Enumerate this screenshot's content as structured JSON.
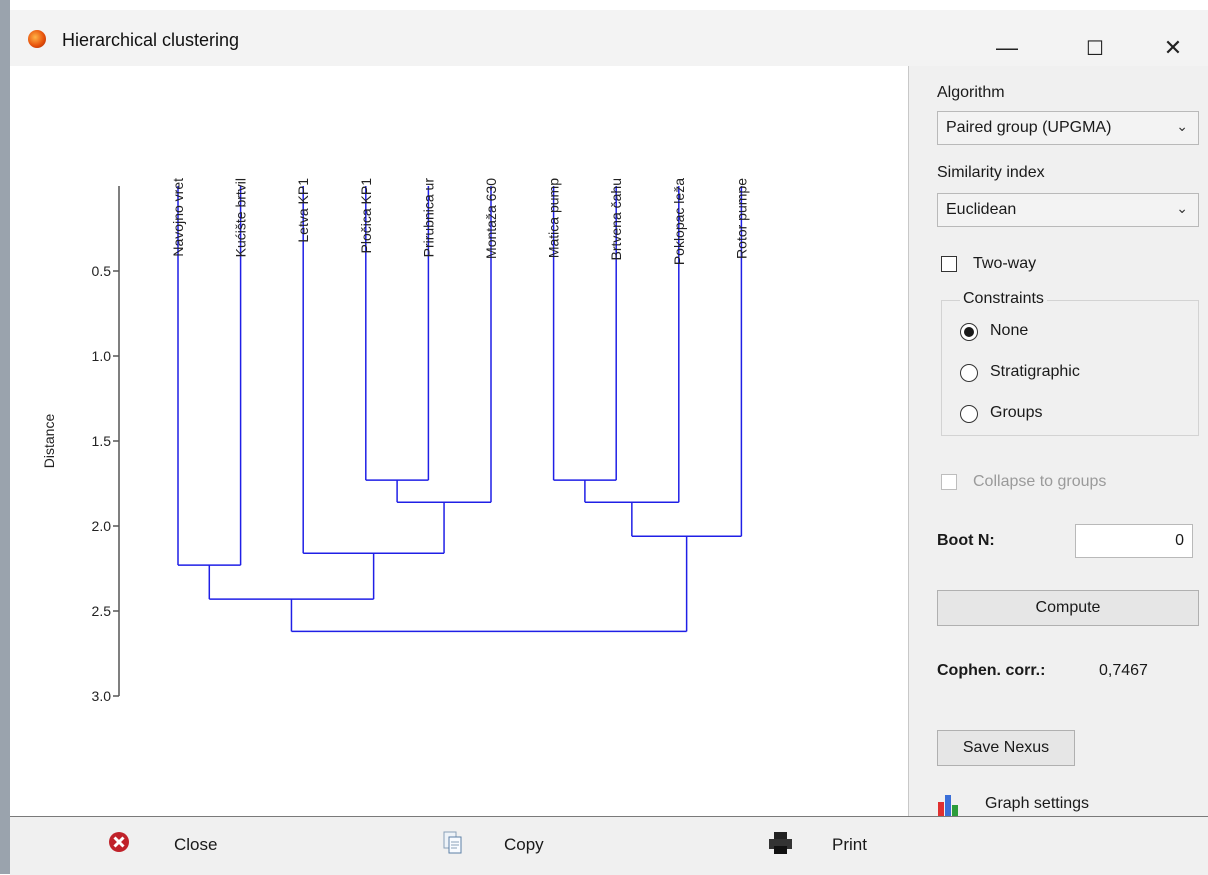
{
  "window": {
    "title": "Hierarchical clustering",
    "minimize": "—",
    "maximize": "☐",
    "close": "✕"
  },
  "chart_data": {
    "type": "dendrogram",
    "ylabel": "Distance",
    "ylim": [
      0,
      3.0
    ],
    "yticks": [
      "0.5",
      "1.0",
      "1.5",
      "2.0",
      "2.5",
      "3.0"
    ],
    "leaves": [
      "Navojno vret",
      "Kućište brtvil",
      "Letva KP1",
      "Pločica KP1",
      "Prirubnica ur",
      "Montaža 630",
      "Matica pump",
      "Brtvena čahu",
      "Poklopac leža",
      "Rotor pumpe"
    ],
    "merges": [
      {
        "a": 3,
        "b": 4,
        "height": 1.73
      },
      {
        "a": 6,
        "b": 7,
        "height": 1.73
      },
      {
        "a": 10,
        "b": 5,
        "height": 1.86
      },
      {
        "a": 11,
        "b": 8,
        "height": 1.86
      },
      {
        "a": 13,
        "b": 9,
        "height": 2.06
      },
      {
        "a": 2,
        "b": 12,
        "height": 2.16
      },
      {
        "a": 0,
        "b": 1,
        "height": 2.23
      },
      {
        "a": 16,
        "b": 15,
        "height": 2.43
      },
      {
        "a": 17,
        "b": 14,
        "height": 2.62
      }
    ],
    "color": "#1f1fe6"
  },
  "sidebar": {
    "algorithm_label": "Algorithm",
    "algorithm_value": "Paired group (UPGMA)",
    "similarity_label": "Similarity index",
    "similarity_value": "Euclidean",
    "two_way_label": "Two-way",
    "constraints_title": "Constraints",
    "constraints": [
      "None",
      "Stratigraphic",
      "Groups"
    ],
    "constraints_selected": "None",
    "collapse_label": "Collapse to groups",
    "boot_label": "Boot N:",
    "boot_value": "0",
    "compute_label": "Compute",
    "cophen_label": "Cophen. corr.:",
    "cophen_value": "0,7467",
    "save_nexus_label": "Save Nexus",
    "graph_settings_label": "Graph settings"
  },
  "statusbar": {
    "close_label": "Close",
    "copy_label": "Copy",
    "print_label": "Print"
  }
}
